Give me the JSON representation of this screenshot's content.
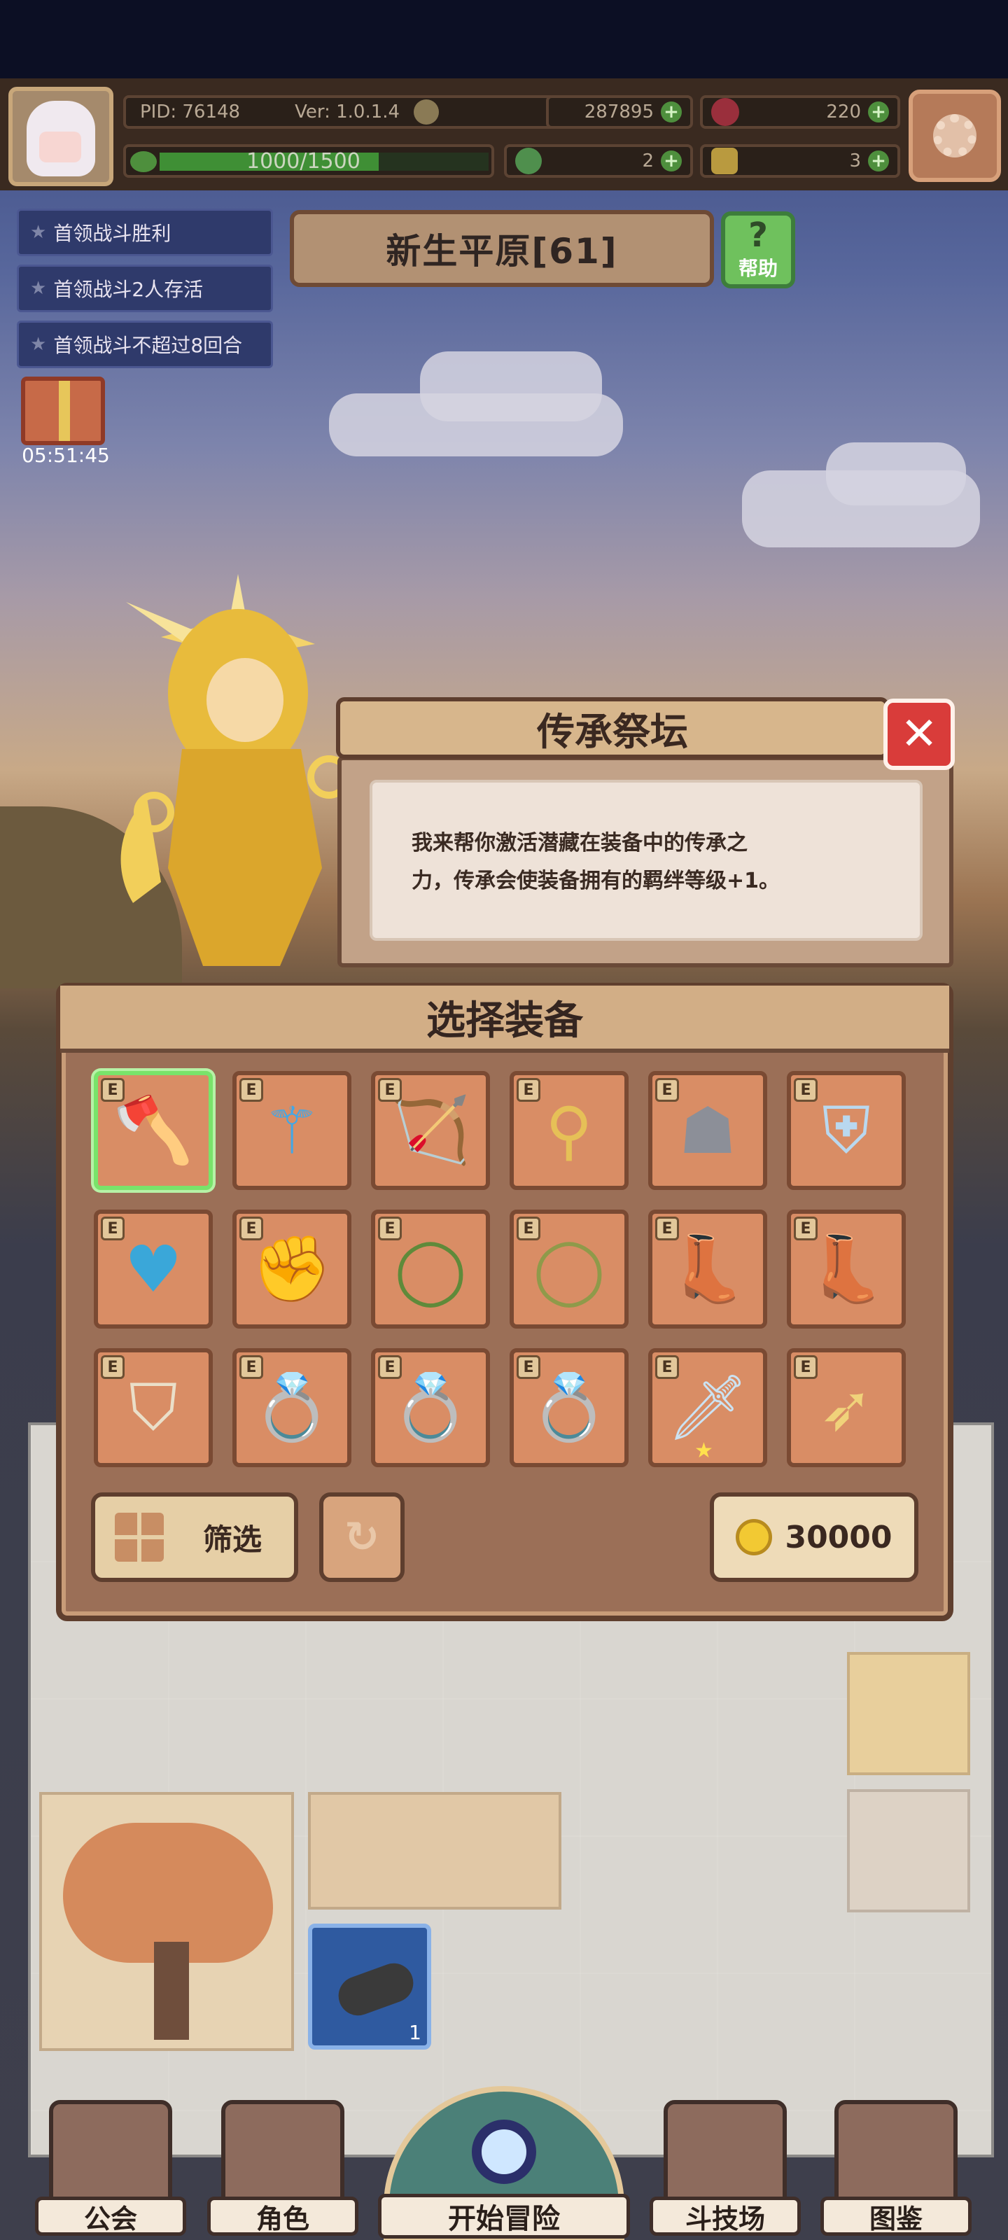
{
  "status": {
    "pid": "PID: 76148",
    "version": "Ver: 1.0.1.4",
    "gold": "287895",
    "gems": "220",
    "exp_text": "1000/1500",
    "exp_fraction": 0.667,
    "clover": "2",
    "hammer": "3"
  },
  "quests": [
    {
      "label": "首领战斗胜利"
    },
    {
      "label": "首领战斗2人存活"
    },
    {
      "label": "首领战斗不超过8回合"
    }
  ],
  "map": {
    "title": "新生平原[61]",
    "help_label": "帮助",
    "help_glyph": "?"
  },
  "gift": {
    "timer": "05:51:45"
  },
  "altar": {
    "title": "传承祭坛",
    "close_glyph": "✕",
    "line1": "我来帮你激活潜藏在装备中的传承之",
    "line2": "力，传承会使装备拥有的羁绊等级+1。"
  },
  "equipment": {
    "title": "选择装备",
    "tag": "E",
    "items": [
      {
        "name": "axe-icon",
        "color": "#d9d2c4",
        "glyph": "🪓"
      },
      {
        "name": "magic-staff-icon",
        "color": "#43a7e6",
        "glyph": "⚚"
      },
      {
        "name": "crossbow-icon",
        "color": "#c9a04a",
        "glyph": "🏹"
      },
      {
        "name": "scepter-icon",
        "color": "#e6c057",
        "glyph": "⚲"
      },
      {
        "name": "hood-helmet-icon",
        "color": "#8c8f98",
        "glyph": "☗"
      },
      {
        "name": "chest-armor-icon",
        "color": "#b9d8ef",
        "glyph": "⛨"
      },
      {
        "name": "blue-cape-icon",
        "color": "#3aa7d9",
        "glyph": "♥"
      },
      {
        "name": "gauntlet-icon",
        "color": "#e04a3a",
        "glyph": "✊"
      },
      {
        "name": "green-belt-icon",
        "color": "#5f8a3a",
        "glyph": "◯"
      },
      {
        "name": "olive-belt-icon",
        "color": "#8f9a4a",
        "glyph": "◯"
      },
      {
        "name": "cloth-boots-icon",
        "color": "#e5dbc6",
        "glyph": "👢"
      },
      {
        "name": "dark-boots-icon",
        "color": "#5c4a6e",
        "glyph": "👢"
      },
      {
        "name": "shell-amulet-icon",
        "color": "#eadfc9",
        "glyph": "⛉"
      },
      {
        "name": "ruby-ring-icon",
        "color": "#c03040",
        "glyph": "💍"
      },
      {
        "name": "gold-ring-icon",
        "color": "#e2a73a",
        "glyph": "💍"
      },
      {
        "name": "sapphire-ring-icon",
        "color": "#3a78d9",
        "glyph": "💍"
      },
      {
        "name": "sword-icon",
        "color": "#cbe2f2",
        "glyph": "🗡"
      },
      {
        "name": "bow-icon",
        "color": "#f0d27a",
        "glyph": "➶"
      }
    ],
    "filter_label": "筛选",
    "refresh_glyph": "↻",
    "cost": "30000"
  },
  "inventory": {
    "wood_count": "1"
  },
  "nav": {
    "guild": "公会",
    "character": "角色",
    "adventure": "开始冒险",
    "arena": "斗技场",
    "codex": "图鉴"
  }
}
